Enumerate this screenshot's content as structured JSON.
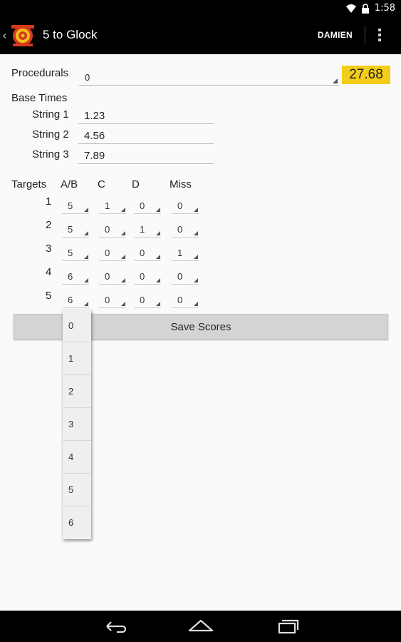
{
  "status": {
    "time": "1:58"
  },
  "app": {
    "title": "5 to Glock",
    "user": "DAMIEN"
  },
  "procedurals": {
    "label": "Procedurals",
    "value": "0",
    "total": "27.68"
  },
  "base_times": {
    "label": "Base Times",
    "strings": [
      {
        "label": "String 1",
        "value": "1.23"
      },
      {
        "label": "String 2",
        "value": "4.56"
      },
      {
        "label": "String 3",
        "value": "7.89"
      }
    ]
  },
  "targets": {
    "headers": [
      "Targets",
      "A/B",
      "C",
      "D",
      "Miss"
    ],
    "rows": [
      {
        "num": "1",
        "values": [
          "5",
          "1",
          "0",
          "0"
        ]
      },
      {
        "num": "2",
        "values": [
          "5",
          "0",
          "1",
          "0"
        ]
      },
      {
        "num": "3",
        "values": [
          "5",
          "0",
          "0",
          "1"
        ]
      },
      {
        "num": "4",
        "values": [
          "6",
          "0",
          "0",
          "0"
        ]
      },
      {
        "num": "5",
        "values": [
          "6",
          "0",
          "0",
          "0"
        ]
      }
    ]
  },
  "save_button": "Save Scores",
  "dropdown": {
    "options": [
      "0",
      "1",
      "2",
      "3",
      "4",
      "5",
      "6"
    ]
  },
  "colors": {
    "total_bg": "#f4cc1a",
    "button_bg": "#d4d4d4"
  },
  "icons": [
    "wifi-icon",
    "lock-icon",
    "back-chevron-icon",
    "app-logo-icon",
    "overflow-menu-icon",
    "nav-back-icon",
    "nav-home-icon",
    "nav-recents-icon"
  ]
}
